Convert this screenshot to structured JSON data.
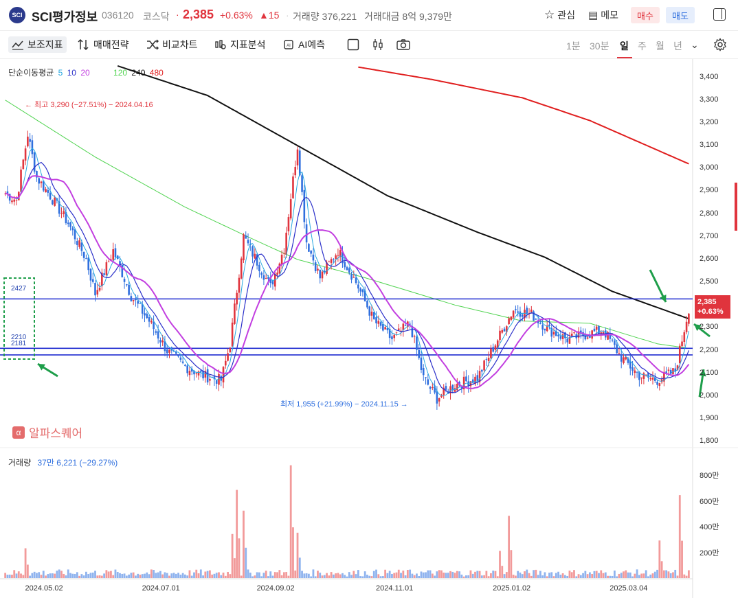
{
  "header": {
    "logo_text": "SCI",
    "name": "SCI평가정보",
    "code": "036120",
    "market": "코스닥",
    "price": "2,385",
    "pct": "+0.63%",
    "change": "▲15",
    "volume": "거래량 376,221",
    "amount": "거래대금 8억 9,379만",
    "watch_label": "관심",
    "memo_label": "메모",
    "buy_label": "매수",
    "sell_label": "매도"
  },
  "toolbar": {
    "items": [
      "보조지표",
      "매매전략",
      "비교차트",
      "지표분석",
      "AI예측"
    ],
    "periods": [
      "1분",
      "30분",
      "일",
      "주",
      "월",
      "년"
    ],
    "active_period": "일"
  },
  "ma_legend": {
    "title": "단순이동평균",
    "values": [
      "5",
      "10",
      "20",
      "120",
      "240",
      "480"
    ],
    "colors": [
      "#29a8e0",
      "#2a2fc9",
      "#c23ee0",
      "#4fd34f",
      "#111111",
      "#e01e1e"
    ]
  },
  "price_badge": {
    "price": "2,385",
    "pct": "+0.63%"
  },
  "annotations": {
    "high": "← 최고 3,290 (−27.51%) − 2024.04.16",
    "low": "최저 1,955 (+21.99%) − 2024.11.15 →"
  },
  "levels": [
    "2427",
    "2210",
    "2181"
  ],
  "watermark": "알파스퀘어",
  "volume_legend": {
    "label": "거래량",
    "value": "37만 6,221 (−29.27%)"
  },
  "colors": {
    "up": "#e0343d",
    "down": "#2f6fde",
    "up_vol": "#f29a9a",
    "down_vol": "#8fb3ee",
    "level_line": "#1f2bd0",
    "arrow": "#1e9e4a"
  },
  "chart_data": {
    "type": "candlestick",
    "price_axis": {
      "ticks": [
        "3,400",
        "3,300",
        "3,200",
        "3,100",
        "3,000",
        "2,900",
        "2,800",
        "2,700",
        "2,600",
        "2,500",
        "2,400",
        "2,300",
        "2,200",
        "2,100",
        "2,000",
        "1,900",
        "1,800"
      ],
      "ylim": [
        1780,
        3450
      ]
    },
    "volume_axis": {
      "ticks": [
        "800만",
        "600만",
        "400만",
        "200만"
      ],
      "ylim": [
        0,
        9000000
      ]
    },
    "x_labels": [
      "2024.05.02",
      "2024.07.01",
      "2024.09.02",
      "2024.11.01",
      "2025.01.02",
      "2025.03.04"
    ],
    "horizontal_levels": [
      2427,
      2210,
      2181
    ],
    "close_path": [
      {
        "i": 0,
        "v": 2890
      },
      {
        "i": 5,
        "v": 2860
      },
      {
        "i": 10,
        "v": 3150
      },
      {
        "i": 14,
        "v": 2960
      },
      {
        "i": 20,
        "v": 2880
      },
      {
        "i": 28,
        "v": 2760
      },
      {
        "i": 36,
        "v": 2600
      },
      {
        "i": 40,
        "v": 2450
      },
      {
        "i": 48,
        "v": 2640
      },
      {
        "i": 56,
        "v": 2440
      },
      {
        "i": 64,
        "v": 2330
      },
      {
        "i": 72,
        "v": 2200
      },
      {
        "i": 80,
        "v": 2130
      },
      {
        "i": 88,
        "v": 2090
      },
      {
        "i": 96,
        "v": 2070
      },
      {
        "i": 100,
        "v": 2230
      },
      {
        "i": 106,
        "v": 2700
      },
      {
        "i": 112,
        "v": 2590
      },
      {
        "i": 118,
        "v": 2480
      },
      {
        "i": 124,
        "v": 2650
      },
      {
        "i": 130,
        "v": 3100
      },
      {
        "i": 134,
        "v": 2680
      },
      {
        "i": 140,
        "v": 2520
      },
      {
        "i": 148,
        "v": 2640
      },
      {
        "i": 156,
        "v": 2500
      },
      {
        "i": 164,
        "v": 2330
      },
      {
        "i": 172,
        "v": 2250
      },
      {
        "i": 180,
        "v": 2320
      },
      {
        "i": 186,
        "v": 2080
      },
      {
        "i": 192,
        "v": 1990
      },
      {
        "i": 200,
        "v": 2050
      },
      {
        "i": 210,
        "v": 2080
      },
      {
        "i": 218,
        "v": 2230
      },
      {
        "i": 226,
        "v": 2380
      },
      {
        "i": 234,
        "v": 2360
      },
      {
        "i": 242,
        "v": 2290
      },
      {
        "i": 250,
        "v": 2250
      },
      {
        "i": 258,
        "v": 2270
      },
      {
        "i": 266,
        "v": 2290
      },
      {
        "i": 274,
        "v": 2170
      },
      {
        "i": 282,
        "v": 2090
      },
      {
        "i": 290,
        "v": 2070
      },
      {
        "i": 298,
        "v": 2110
      },
      {
        "i": 304,
        "v": 2385
      }
    ],
    "ma_series": [
      {
        "name": "120",
        "points": [
          {
            "i": 0,
            "v": 3300
          },
          {
            "i": 40,
            "v": 3050
          },
          {
            "i": 80,
            "v": 2830
          },
          {
            "i": 110,
            "v": 2690
          },
          {
            "i": 130,
            "v": 2600
          },
          {
            "i": 160,
            "v": 2520
          },
          {
            "i": 200,
            "v": 2400
          },
          {
            "i": 230,
            "v": 2330
          },
          {
            "i": 260,
            "v": 2320
          },
          {
            "i": 290,
            "v": 2230
          },
          {
            "i": 304,
            "v": 2210
          }
        ]
      },
      {
        "name": "240",
        "points": [
          {
            "i": 50,
            "v": 3450
          },
          {
            "i": 90,
            "v": 3320
          },
          {
            "i": 130,
            "v": 3100
          },
          {
            "i": 170,
            "v": 2880
          },
          {
            "i": 210,
            "v": 2720
          },
          {
            "i": 240,
            "v": 2610
          },
          {
            "i": 270,
            "v": 2460
          },
          {
            "i": 304,
            "v": 2340
          }
        ]
      },
      {
        "name": "480",
        "points": [
          {
            "i": 157,
            "v": 3445
          },
          {
            "i": 190,
            "v": 3390
          },
          {
            "i": 230,
            "v": 3310
          },
          {
            "i": 260,
            "v": 3210
          },
          {
            "i": 304,
            "v": 3020
          }
        ]
      }
    ],
    "volume_spikes": [
      {
        "i": 9,
        "v": 2300000,
        "up": true
      },
      {
        "i": 101,
        "v": 3400000,
        "up": true
      },
      {
        "i": 103,
        "v": 6800000,
        "up": true
      },
      {
        "i": 106,
        "v": 5200000,
        "up": true
      },
      {
        "i": 127,
        "v": 8700000,
        "up": false
      },
      {
        "i": 130,
        "v": 3500000,
        "up": true
      },
      {
        "i": 224,
        "v": 4800000,
        "up": true
      },
      {
        "i": 220,
        "v": 2100000,
        "up": true
      },
      {
        "i": 291,
        "v": 2900000,
        "up": false
      },
      {
        "i": 300,
        "v": 6400000,
        "up": true
      }
    ]
  }
}
